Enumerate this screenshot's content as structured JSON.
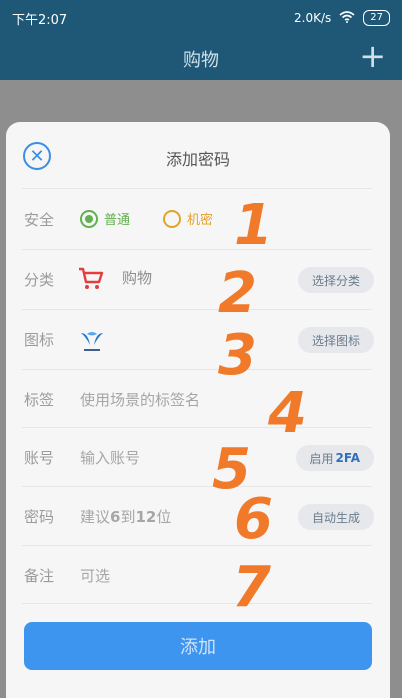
{
  "status": {
    "time": "下午2:07",
    "speed": "2.0K/s",
    "battery": "27"
  },
  "appbar": {
    "title": "购物",
    "add": "+"
  },
  "sheet": {
    "title": "添加密码",
    "rows": {
      "security": {
        "label": "安全",
        "option1": "普通",
        "option2": "机密"
      },
      "category": {
        "label": "分类",
        "value": "购物",
        "button": "选择分类"
      },
      "icon": {
        "label": "图标",
        "button": "选择图标"
      },
      "tag": {
        "label": "标签",
        "placeholder": "使用场景的标签名"
      },
      "account": {
        "label": "账号",
        "placeholder": "输入账号",
        "button_prefix": "启用",
        "button_bold": "2FA"
      },
      "password": {
        "label": "密码",
        "placeholder_prefix": "建议",
        "placeholder_n1": "6",
        "placeholder_mid": "到",
        "placeholder_n2": "12",
        "placeholder_suffix": "位",
        "button": "自动生成"
      },
      "note": {
        "label": "备注",
        "placeholder": "可选"
      }
    },
    "submit": "添加"
  },
  "annotations": [
    "1",
    "2",
    "3",
    "4",
    "5",
    "6",
    "7"
  ],
  "colors": {
    "primary": "#3d95ef",
    "green": "#62b04f",
    "orange": "#e3a22b",
    "annotation": "#f07a2a",
    "bar": "#1f5876"
  }
}
